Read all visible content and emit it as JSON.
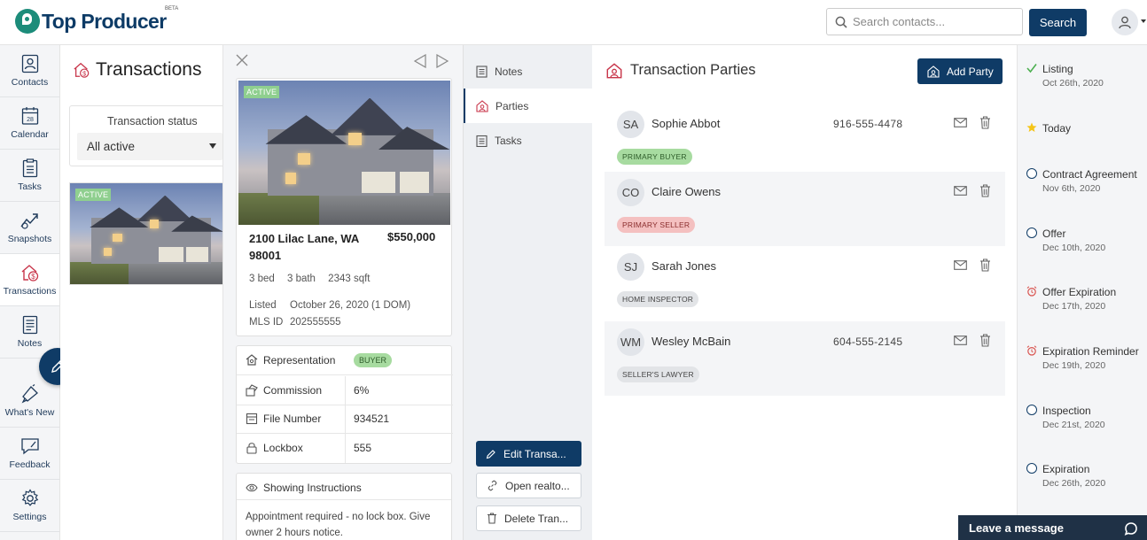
{
  "app": {
    "name": "Top Producer",
    "badge": "BETA"
  },
  "header": {
    "search_placeholder": "Search contacts...",
    "search_button": "Search"
  },
  "nav": [
    {
      "label": "Contacts",
      "icon": "contacts-icon"
    },
    {
      "label": "Calendar",
      "icon": "calendar-icon",
      "day": "28"
    },
    {
      "label": "Tasks",
      "icon": "tasks-icon"
    },
    {
      "label": "Snapshots",
      "icon": "snapshots-icon"
    },
    {
      "label": "Transactions",
      "icon": "transactions-icon",
      "active": true
    },
    {
      "label": "Notes",
      "icon": "notes-icon"
    },
    {
      "label": "What's New",
      "icon": "whats-new-icon"
    },
    {
      "label": "Feedback",
      "icon": "feedback-icon"
    },
    {
      "label": "Settings",
      "icon": "settings-icon"
    }
  ],
  "transactions": {
    "title": "Transactions",
    "status_label": "Transaction status",
    "status_value": "All active",
    "card_badge": "ACTIVE"
  },
  "property": {
    "badge": "ACTIVE",
    "address_line1": "2100 Lilac Lane, WA",
    "address_line2": "98001",
    "price": "$550,000",
    "beds": "3 bed",
    "baths": "3 bath",
    "sqft": "2343 sqft",
    "listed_label": "Listed",
    "listed_value": "October 26, 2020 (1 DOM)",
    "mls_label": "MLS ID",
    "mls_value": "202555555"
  },
  "details": [
    {
      "label": "Representation",
      "value": "BUYER",
      "badge": true,
      "icon": "handshake-icon"
    },
    {
      "label": "Commission",
      "value": "6%",
      "icon": "commission-icon"
    },
    {
      "label": "File Number",
      "value": "934521",
      "icon": "file-icon"
    },
    {
      "label": "Lockbox",
      "value": "555",
      "icon": "lock-icon"
    }
  ],
  "showing": {
    "title": "Showing Instructions",
    "line1": "Appointment required - no lock box. Give",
    "line2": "owner 2 hours notice."
  },
  "tabs": [
    {
      "label": "Notes",
      "icon": "notes-icon"
    },
    {
      "label": "Parties",
      "icon": "parties-icon",
      "active": true
    },
    {
      "label": "Tasks",
      "icon": "tasks-icon"
    }
  ],
  "actions": {
    "edit": "Edit Transa...",
    "open": "Open realto...",
    "delete": "Delete Tran..."
  },
  "parties": {
    "title": "Transaction Parties",
    "add_button": "Add Party",
    "items": [
      {
        "initials": "SA",
        "name": "Sophie Abbot",
        "phone": "916-555-4478",
        "role": "PRIMARY BUYER",
        "role_color": "green"
      },
      {
        "initials": "CO",
        "name": "Claire Owens",
        "phone": "",
        "role": "PRIMARY SELLER",
        "role_color": "pink"
      },
      {
        "initials": "SJ",
        "name": "Sarah Jones",
        "phone": "",
        "role": "HOME INSPECTOR",
        "role_color": "gray"
      },
      {
        "initials": "WM",
        "name": "Wesley McBain",
        "phone": "604-555-2145",
        "role": "SELLER'S LAWYER",
        "role_color": "gray"
      }
    ]
  },
  "timeline": [
    {
      "title": "Listing",
      "date": "Oct 26th, 2020",
      "icon": "check-icon"
    },
    {
      "title": "Today",
      "date": "",
      "icon": "star-icon"
    },
    {
      "title": "Contract Agreement",
      "date": "Nov 6th, 2020",
      "icon": "circle-icon"
    },
    {
      "title": "Offer",
      "date": "Dec 10th, 2020",
      "icon": "circle-icon"
    },
    {
      "title": "Offer Expiration",
      "date": "Dec 17th, 2020",
      "icon": "alarm-icon"
    },
    {
      "title": "Expiration Reminder",
      "date": "Dec 19th, 2020",
      "icon": "alarm-icon"
    },
    {
      "title": "Inspection",
      "date": "Dec 21st, 2020",
      "icon": "circle-icon"
    },
    {
      "title": "Expiration",
      "date": "Dec 26th, 2020",
      "icon": "circle-icon"
    }
  ],
  "chat": {
    "label": "Leave a message"
  },
  "colors": {
    "primary": "#0f3b66",
    "brand_teal": "#1c8c7a",
    "green_badge": "#a7dba0",
    "pink_badge": "#f4c0c0",
    "alarm": "#d9534f",
    "star": "#f5c518"
  }
}
